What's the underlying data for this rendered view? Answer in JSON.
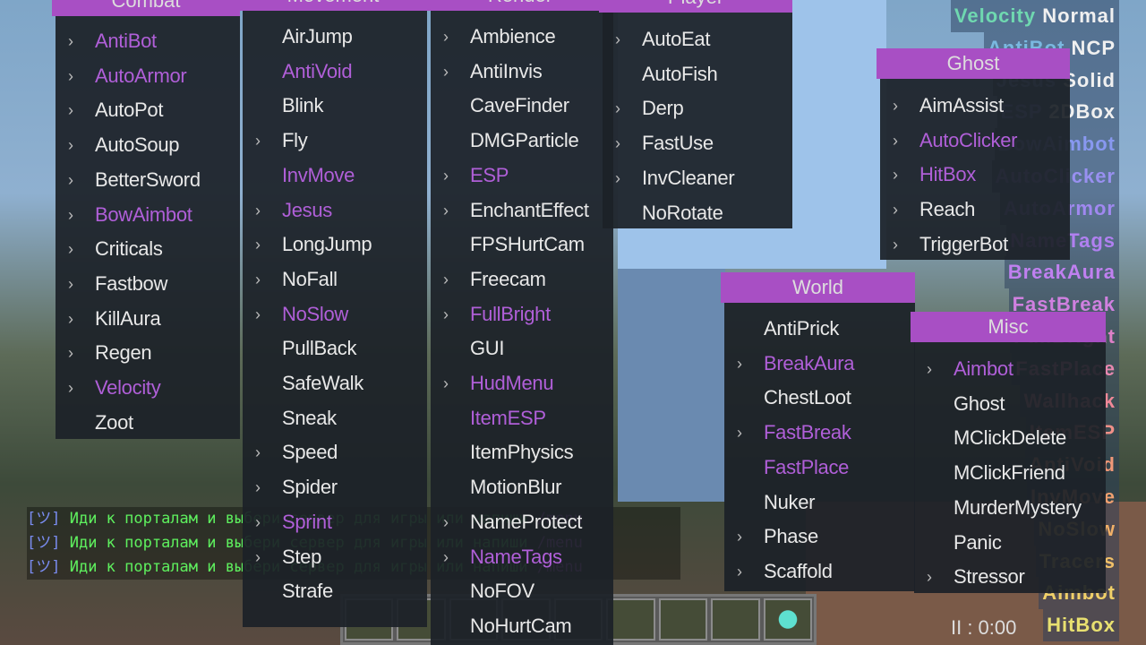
{
  "colors": {
    "accent": "#a84fc4",
    "enabled": "#b05fd8",
    "panel": "#1c2128",
    "text": "#e8e8e8"
  },
  "panels": [
    {
      "id": "combat",
      "title": "Combat",
      "items": [
        [
          "AntiBot",
          1,
          1
        ],
        [
          "AutoArmor",
          1,
          1
        ],
        [
          "AutoPot",
          1,
          0
        ],
        [
          "AutoSoup",
          1,
          0
        ],
        [
          "BetterSword",
          1,
          0
        ],
        [
          "BowAimbot",
          1,
          1
        ],
        [
          "Criticals",
          1,
          0
        ],
        [
          "Fastbow",
          1,
          0
        ],
        [
          "KillAura",
          1,
          0
        ],
        [
          "Regen",
          1,
          0
        ],
        [
          "Velocity",
          1,
          1
        ],
        [
          "Zoot",
          0,
          0
        ]
      ]
    },
    {
      "id": "movement",
      "title": "Movement",
      "items": [
        [
          "AirJump",
          0,
          0
        ],
        [
          "AntiVoid",
          0,
          1
        ],
        [
          "Blink",
          0,
          0
        ],
        [
          "Fly",
          1,
          0
        ],
        [
          "InvMove",
          0,
          1
        ],
        [
          "Jesus",
          1,
          1
        ],
        [
          "LongJump",
          1,
          0
        ],
        [
          "NoFall",
          1,
          0
        ],
        [
          "NoSlow",
          1,
          1
        ],
        [
          "PullBack",
          0,
          0
        ],
        [
          "SafeWalk",
          0,
          0
        ],
        [
          "Sneak",
          0,
          0
        ],
        [
          "Speed",
          1,
          0
        ],
        [
          "Spider",
          1,
          0
        ],
        [
          "Sprint",
          1,
          1
        ],
        [
          "Step",
          1,
          0
        ],
        [
          "Strafe",
          0,
          0
        ]
      ]
    },
    {
      "id": "render",
      "title": "Render",
      "items": [
        [
          "Ambience",
          1,
          0
        ],
        [
          "AntiInvis",
          1,
          0
        ],
        [
          "CaveFinder",
          0,
          0
        ],
        [
          "DMGParticle",
          0,
          0
        ],
        [
          "ESP",
          1,
          1
        ],
        [
          "EnchantEffect",
          1,
          0
        ],
        [
          "FPSHurtCam",
          0,
          0
        ],
        [
          "Freecam",
          1,
          0
        ],
        [
          "FullBright",
          1,
          1
        ],
        [
          "GUI",
          0,
          0
        ],
        [
          "HudMenu",
          1,
          1
        ],
        [
          "ItemESP",
          0,
          1
        ],
        [
          "ItemPhysics",
          0,
          0
        ],
        [
          "MotionBlur",
          0,
          0
        ],
        [
          "NameProtect",
          1,
          0
        ],
        [
          "NameTags",
          1,
          1
        ],
        [
          "NoFOV",
          0,
          0
        ],
        [
          "NoHurtCam",
          0,
          0
        ]
      ]
    },
    {
      "id": "player",
      "title": "Player",
      "items": [
        [
          "AutoEat",
          1,
          0
        ],
        [
          "AutoFish",
          0,
          0
        ],
        [
          "Derp",
          1,
          0
        ],
        [
          "FastUse",
          1,
          0
        ],
        [
          "InvCleaner",
          1,
          0
        ],
        [
          "NoRotate",
          0,
          0
        ]
      ]
    },
    {
      "id": "ghost",
      "title": "Ghost",
      "items": [
        [
          "AimAssist",
          1,
          0
        ],
        [
          "AutoClicker",
          1,
          1
        ],
        [
          "HitBox",
          1,
          1
        ],
        [
          "Reach",
          1,
          0
        ],
        [
          "TriggerBot",
          1,
          0
        ]
      ]
    },
    {
      "id": "world",
      "title": "World",
      "items": [
        [
          "AntiPrick",
          0,
          0
        ],
        [
          "BreakAura",
          1,
          1
        ],
        [
          "ChestLoot",
          0,
          0
        ],
        [
          "FastBreak",
          1,
          1
        ],
        [
          "FastPlace",
          0,
          1
        ],
        [
          "Nuker",
          0,
          0
        ],
        [
          "Phase",
          1,
          0
        ],
        [
          "Scaffold",
          1,
          0
        ]
      ]
    },
    {
      "id": "misc",
      "title": "Misc",
      "items": [
        [
          "Aimbot",
          1,
          1
        ],
        [
          "Ghost",
          0,
          0
        ],
        [
          "MClickDelete",
          0,
          0
        ],
        [
          "MClickFriend",
          0,
          0
        ],
        [
          "MurderMystery",
          0,
          0
        ],
        [
          "Panic",
          0,
          0
        ],
        [
          "Stressor",
          1,
          0
        ]
      ]
    }
  ],
  "arraylist": [
    [
      "Velocity",
      "Normal",
      "#6fd8b0"
    ],
    [
      "AntiBot",
      "NCP",
      "#7ab8e0"
    ],
    [
      "Jesus",
      "Solid",
      "#88a8e8"
    ],
    [
      "ESP",
      "2DBox",
      "#90a0f0"
    ],
    [
      "BowAimbot",
      "",
      "#8898f0"
    ],
    [
      "AutoClicker",
      "",
      "#9890f0"
    ],
    [
      "AutoArmor",
      "",
      "#a088f0"
    ],
    [
      "NameTags",
      "",
      "#b080f0"
    ],
    [
      "BreakAura",
      "",
      "#c080f0"
    ],
    [
      "FastBreak",
      "",
      "#d080e0"
    ],
    [
      "FullBright",
      "",
      "#e080c8"
    ],
    [
      "FastPlace",
      "",
      "#e888b0"
    ],
    [
      "Wallhack",
      "",
      "#f08898"
    ],
    [
      "ItemESP",
      "",
      "#f09088"
    ],
    [
      "AntiVoid",
      "",
      "#f09878"
    ],
    [
      "InvMove",
      "",
      "#f0a070"
    ],
    [
      "NoSlow",
      "",
      "#f0b068"
    ],
    [
      "Tracers",
      "",
      "#f0c068"
    ],
    [
      "Aimbot",
      "",
      "#f0d068"
    ],
    [
      "HitBox",
      "",
      "#e8e070"
    ]
  ],
  "chat": {
    "tag": "[ツ]",
    "message": " Иди к порталам и выбери сервер для игры или напиши ",
    "command": "/menu",
    "count": 3
  },
  "timer": "II : 0:00"
}
